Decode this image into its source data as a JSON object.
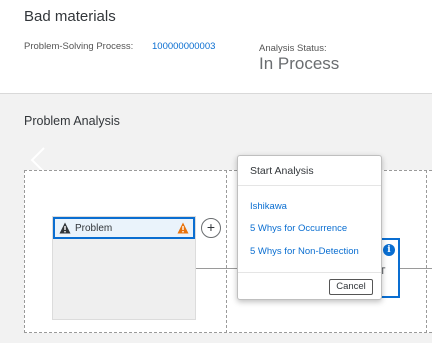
{
  "header": {
    "title": "Bad materials",
    "process_label": "Problem-Solving Process:",
    "process_value": "100000000003",
    "status_label": "Analysis Status:",
    "status_value": "In Process"
  },
  "section": {
    "title": "Problem Analysis"
  },
  "problem_node": {
    "label": "Problem",
    "icons": [
      "warning-icon",
      "warning-orange-icon"
    ]
  },
  "add_button": {
    "label": "+"
  },
  "secondary_node": {
    "text": "ST",
    "icon": "info-icon"
  },
  "popover": {
    "title": "Start Analysis",
    "items": [
      "Ishikawa",
      "5 Whys for Occurrence",
      "5 Whys for Non-Detection"
    ],
    "cancel_label": "Cancel"
  },
  "colors": {
    "accent": "#0a6ed1",
    "warning": "#e9730c",
    "background": "#f2f2f2"
  }
}
